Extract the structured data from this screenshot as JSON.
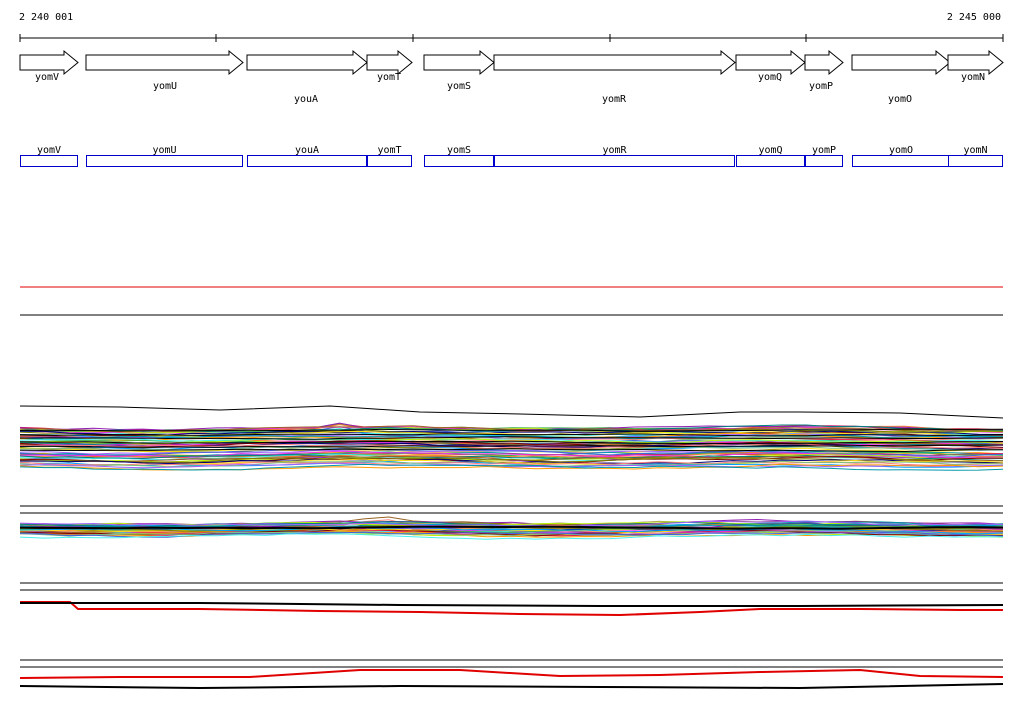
{
  "ruler": {
    "start_label": "2 240 001",
    "end_label": "2 245 000"
  },
  "genes": [
    {
      "name": "yomV"
    },
    {
      "name": "yomU"
    },
    {
      "name": "youA"
    },
    {
      "name": "yomT"
    },
    {
      "name": "yomS"
    },
    {
      "name": "yomR"
    },
    {
      "name": "yomQ"
    },
    {
      "name": "yomP"
    },
    {
      "name": "yomO"
    },
    {
      "name": "yomN"
    }
  ],
  "colors": {
    "gene_box": "#0000cc",
    "arrow": "#000000",
    "marker_line": "#e00000",
    "track_border": "#000000",
    "palette": [
      "#e6194b",
      "#3cb44b",
      "#4363d8",
      "#f58231",
      "#911eb4",
      "#46f0f0",
      "#f032e6",
      "#bcf60c",
      "#008080",
      "#9a6324",
      "#800000",
      "#808000",
      "#000075",
      "#ffe119",
      "#00a0ff",
      "#ff7f7f",
      "#7fbf7f",
      "#a060ff",
      "#ff9900",
      "#0099aa"
    ]
  }
}
